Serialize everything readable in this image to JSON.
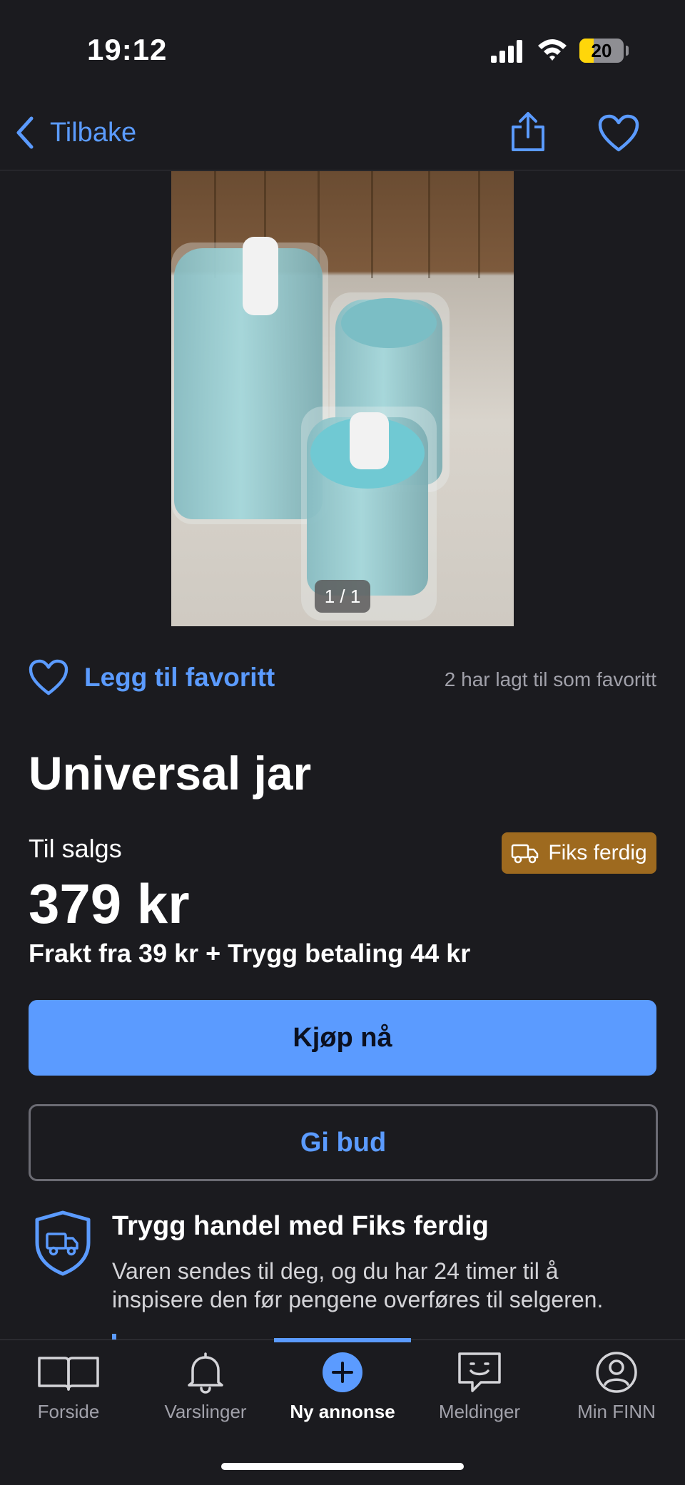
{
  "status_bar": {
    "time": "19:12",
    "battery": "20"
  },
  "nav": {
    "back_label": "Tilbake"
  },
  "gallery": {
    "counter": "1 / 1"
  },
  "favorite": {
    "label": "Legg til favoritt",
    "count_text": "2 har lagt til som favoritt"
  },
  "listing": {
    "title": "Universal jar",
    "sale_label": "Til salgs",
    "price": "379 kr",
    "shipping": "Frakt fra 39 kr + Trygg betaling 44 kr",
    "badge": "Fiks ferdig"
  },
  "actions": {
    "buy": "Kjøp nå",
    "bid": "Gi bud"
  },
  "safe_trade": {
    "title": "Trygg handel med Fiks ferdig",
    "text": "Varen sendes til deg, og du har 24 timer til å inspisere den før pengene overføres til selgeren."
  },
  "tabs": [
    {
      "label": "Forside",
      "icon": "book-icon"
    },
    {
      "label": "Varslinger",
      "icon": "bell-icon"
    },
    {
      "label": "Ny annonse",
      "icon": "plus-circle-icon"
    },
    {
      "label": "Meldinger",
      "icon": "chat-icon"
    },
    {
      "label": "Min FINN",
      "icon": "profile-icon"
    }
  ],
  "colors": {
    "accent": "#5b9bff",
    "badge": "#9e6a1f",
    "background": "#1b1b1f"
  }
}
